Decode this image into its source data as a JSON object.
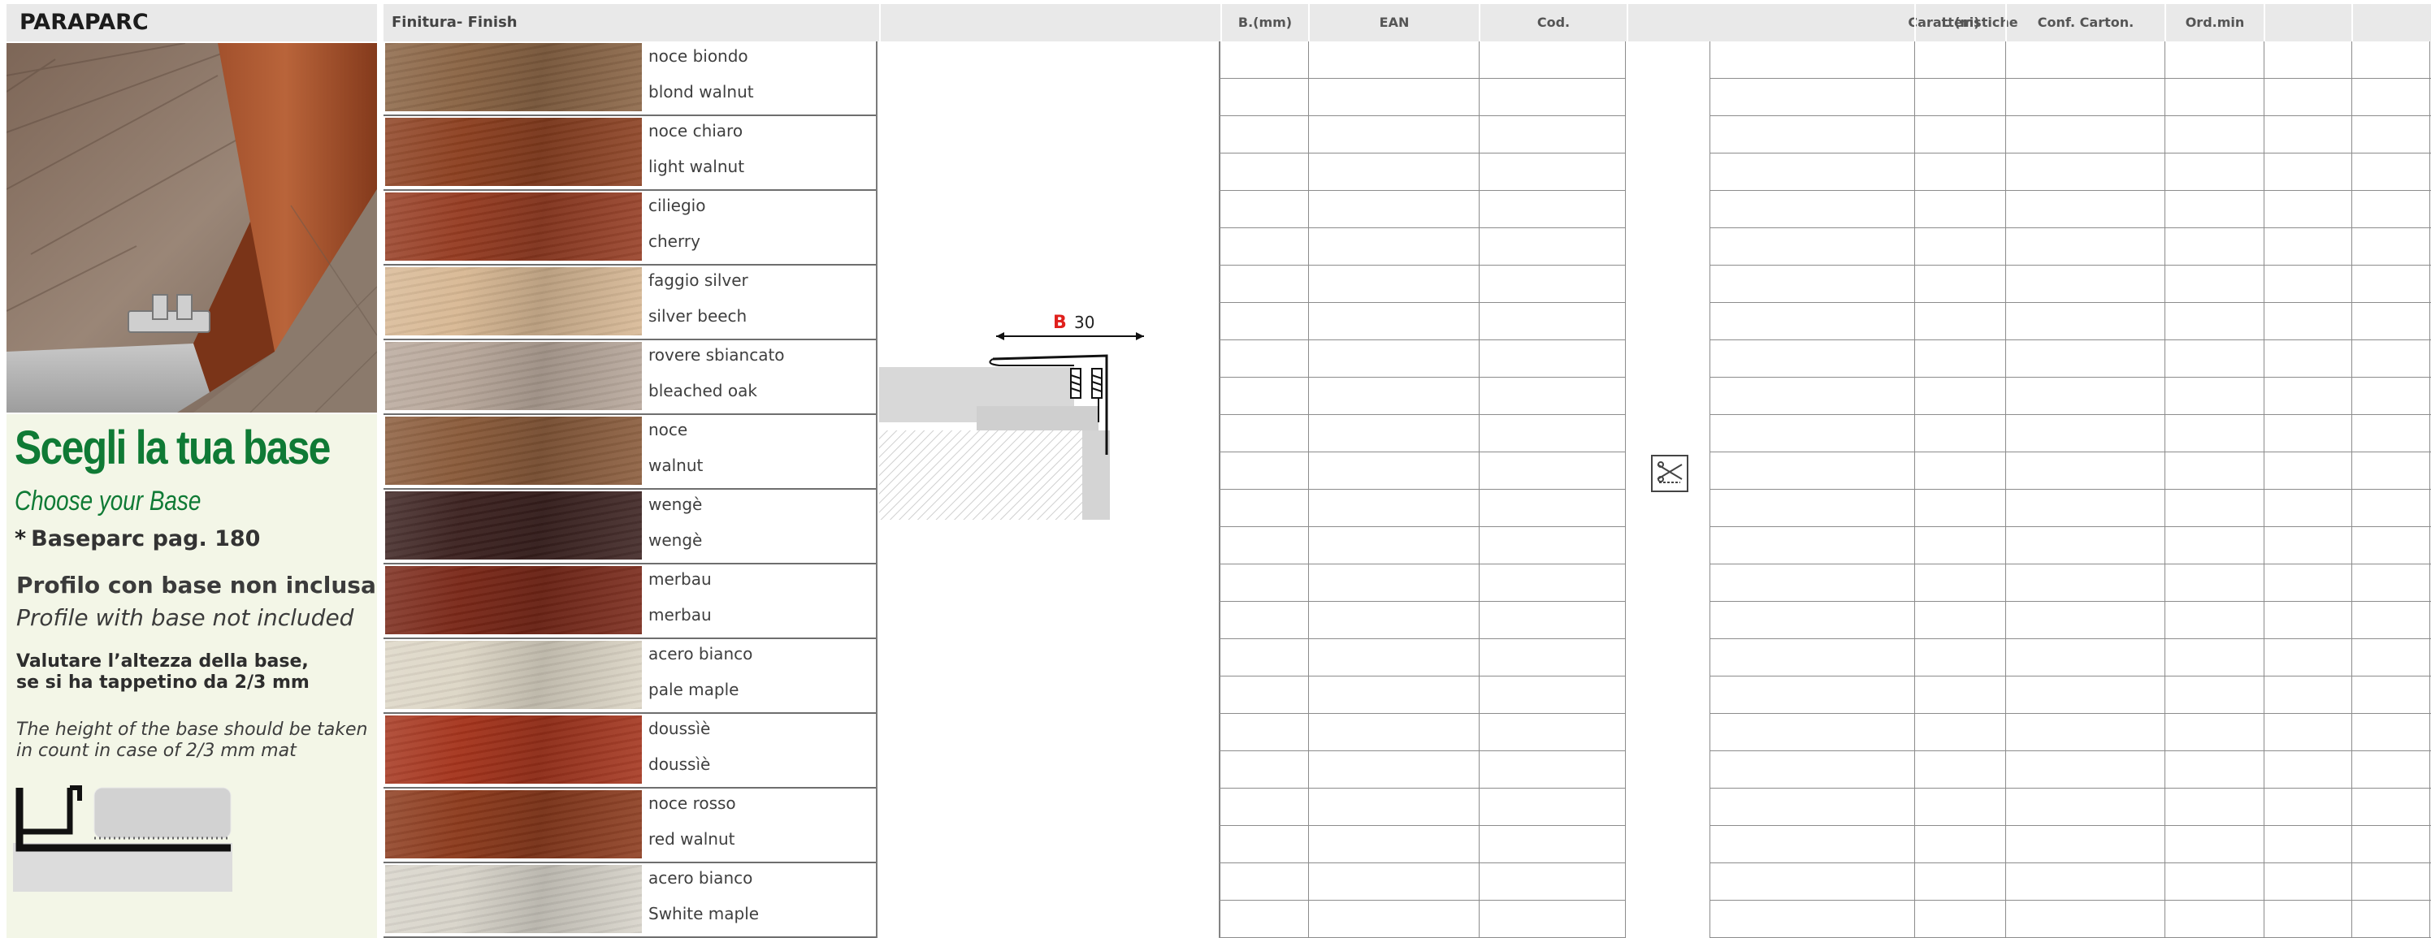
{
  "product": {
    "name": "PARAPARC"
  },
  "left_panel": {
    "title_it": "Scegli la tua base",
    "title_en": "Choose your Base",
    "base_note_star": "*",
    "base_note": "Baseparc pag. 180",
    "profile_it": "Profilo con base non inclusa",
    "profile_en": "Profile with base not included",
    "valuate_line1": "Valutare l’altezza della base,",
    "valuate_line2": "se si ha tappetino da 2/3 mm",
    "height_line1": "The height of the base should be taken",
    "height_line2": "in count in case of 2/3 mm mat"
  },
  "table": {
    "headers": {
      "finish": "Finitura- Finish",
      "b": "B.(mm)",
      "ean": "EAN",
      "cod": "Cod.",
      "features": "Caratteristiche",
      "length": "L (m)",
      "carton": "Conf. Carton.",
      "min_order": "Ord.min"
    },
    "finishes": [
      {
        "it": "noce biondo",
        "en": "blond walnut",
        "color": "#8a6444"
      },
      {
        "it": "noce chiaro",
        "en": "light walnut",
        "color": "#8d4020"
      },
      {
        "it": "ciliegio",
        "en": "cherry",
        "color": "#963c22"
      },
      {
        "it": "faggio silver",
        "en": "silver beech",
        "color": "#d8b894"
      },
      {
        "it": "rovere sbiancato",
        "en": "bleached oak",
        "color": "#b8a89b"
      },
      {
        "it": "noce",
        "en": "walnut",
        "color": "#8a5b3a"
      },
      {
        "it": "wengè",
        "en": "wengè",
        "color": "#3c2220"
      },
      {
        "it": "merbau",
        "en": "merbau",
        "color": "#7a2818"
      },
      {
        "it": "acero bianco",
        "en": "pale maple",
        "color": "#ddd6c6"
      },
      {
        "it": "doussìè",
        "en": "doussìè",
        "color": "#a5341c"
      },
      {
        "it": "noce rosso",
        "en": "red walnut",
        "color": "#8c3a1c"
      },
      {
        "it": "acero bianco",
        "en": "Swhite maple",
        "color": "#d8d4ca"
      }
    ]
  },
  "drawing": {
    "dim_letter": "B",
    "dim_value": "30"
  },
  "icons": {
    "features_icon": "cut-to-size-icon"
  },
  "colors": {
    "accent_green": "#0f7a35",
    "header_gray": "#e9e9e9",
    "panel_cream": "#f3f6e7",
    "dim_red": "#e0201c"
  }
}
